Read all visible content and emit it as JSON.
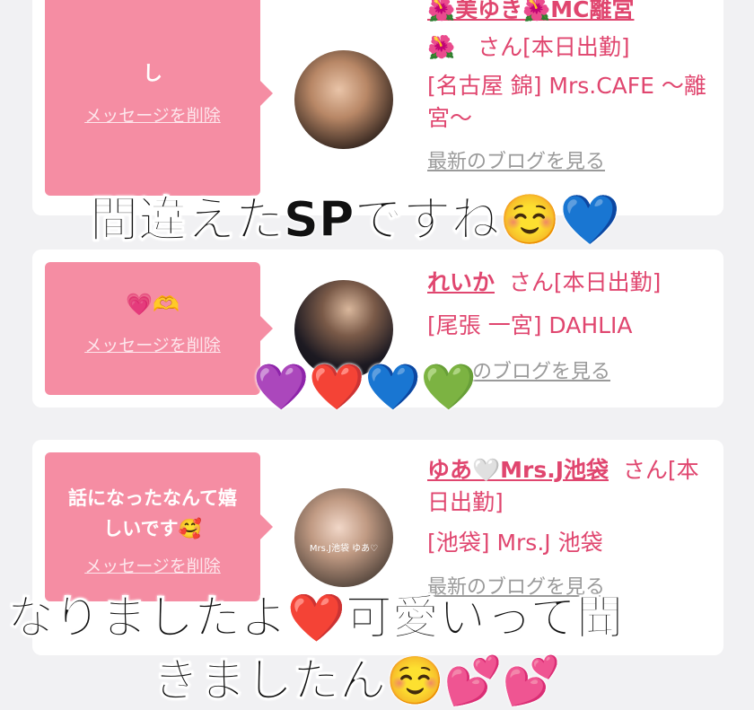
{
  "cards": [
    {
      "message": "し",
      "delete_label": "メッセージを削除",
      "name": "🌺美ゆき🌺MC離宮",
      "suffix": "🌺　さん[本日出勤]",
      "shop": "[名古屋 錦] Mrs.CAFE ～離宮～",
      "blog": "最新のブログを見る"
    },
    {
      "message": "💗🫶",
      "delete_label": "メッセージを削除",
      "name": "れいか",
      "suffix": "さん[本日出勤]",
      "shop": "[尾張 一宮] DAHLIA",
      "blog": "のブログを見る"
    },
    {
      "message": "話になったなんて嬉しいです🥰",
      "delete_label": "メッセージを削除",
      "name": "ゆあ🤍Mrs.J池袋",
      "suffix": "さん[本日出勤]",
      "shop": "[池袋] Mrs.J 池袋",
      "blog": "最新のブログを見る",
      "avatar_caption": "Mrs.J池袋 ゆあ♡"
    }
  ],
  "overlays": {
    "caption1": "間違えたSPですね☺️💙",
    "hearts": "💜❤️💙💚",
    "caption2_line1": "なりましたよ❤️可愛いって聞",
    "caption2_line2": "きましたん☺️💕💕"
  },
  "colors": {
    "accent": "#e0466f",
    "bubble": "#f58da3"
  }
}
